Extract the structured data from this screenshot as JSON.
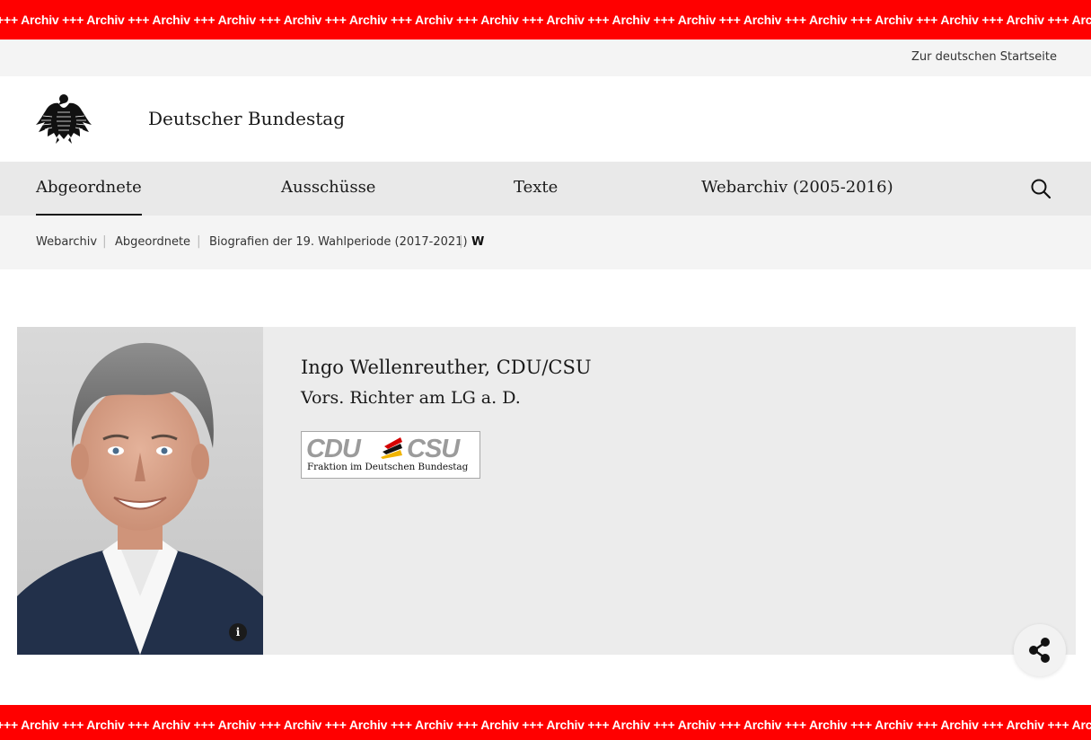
{
  "archive_banner": {
    "text": "+++ Archiv +++ Archiv +++ Archiv +++ Archiv +++ Archiv +++ Archiv +++ Archiv +++ Archiv +++ Archiv +++ Archiv +++ Archiv +++ Archiv +++ Archiv +++ Archiv +++ Archiv +++ Archiv +++ Archiv +++ Archiv"
  },
  "utility": {
    "home_link": "Zur deutschen Startseite"
  },
  "brand": {
    "name": "Deutscher Bundestag",
    "logo_icon": "bundesadler-icon"
  },
  "nav": {
    "items": [
      {
        "label": "Abgeordnete",
        "active": true
      },
      {
        "label": "Ausschüsse",
        "active": false
      },
      {
        "label": "Texte",
        "active": false
      },
      {
        "label": "Webarchiv (2005-2016)",
        "active": false
      }
    ],
    "search_icon": "search-icon"
  },
  "breadcrumb": {
    "items": [
      "Webarchiv",
      "Abgeordnete",
      "Biografien der 19. Wahlperiode (2017-2021)"
    ],
    "separator": "|",
    "current": "W"
  },
  "profile": {
    "name": "Ingo Wellenreuther, CDU/CSU",
    "title": "Vors. Richter am LG a. D.",
    "party_logo": {
      "left_text": "CDU",
      "right_text": "CSU",
      "caption": "Fraktion im Deutschen Bundestag"
    },
    "info_label": "i"
  },
  "colors": {
    "archive_red": "#ff0000",
    "nav_bg": "#e9e9e9",
    "card_bg": "#ececec"
  }
}
